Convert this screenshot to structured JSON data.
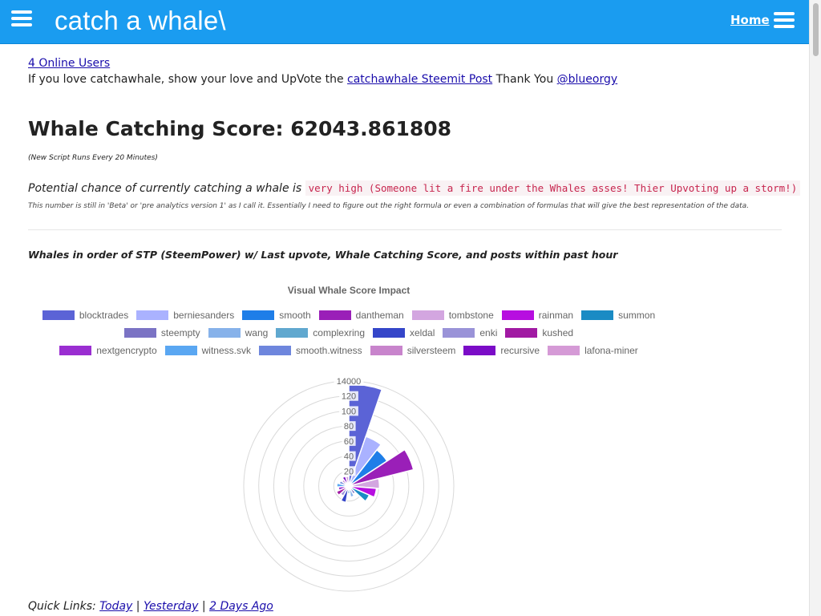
{
  "header": {
    "title": "catch a whale\\",
    "home_label": "Home"
  },
  "online_users": "4 Online Users",
  "love": {
    "prefix": "If you love catchawhale, show your love and UpVote the ",
    "post_link": "catchawhale Steemit Post",
    "middle": " Thank You ",
    "user_link": "@blueorgy"
  },
  "score_title": "Whale Catching Score: 62043.861808",
  "script_note": "(New Script Runs Every 20 Minutes)",
  "potential": {
    "prefix": "Potential chance of currently catching a whale is ",
    "value": "very high (Someone lit a fire under the Whales asses! Thier Upvoting up a storm!)"
  },
  "beta_note": "This number is still in 'Beta' or 'pre analytics version 1' as I call it. Essentially I need to figure out the right formula or even a combination of formulas that will give the best representation of the data.",
  "whales_heading": "Whales in order of STP (SteemPower) w/ Last upvote, Whale Catching Score, and posts within past hour",
  "quick_links": {
    "label": "Quick Links:",
    "today": "Today",
    "yesterday": "Yesterday",
    "two_days": "2 Days Ago"
  },
  "chart_data": {
    "type": "polarArea",
    "title": "Visual Whale Score Impact",
    "legend_position": "top",
    "r_ticks": [
      "20",
      "40",
      "60",
      "80",
      "100",
      "120",
      "14000"
    ],
    "rmax": 14000,
    "series": [
      {
        "name": "blocktrades",
        "value": 13600,
        "color": "#5b63d6"
      },
      {
        "name": "berniesanders",
        "value": 7000,
        "color": "#aab2ff"
      },
      {
        "name": "smooth",
        "value": 6100,
        "color": "#1e7ee8"
      },
      {
        "name": "dantheman",
        "value": 8900,
        "color": "#9a1fb8"
      },
      {
        "name": "tombstone",
        "value": 4100,
        "color": "#d3a6e0"
      },
      {
        "name": "rainman",
        "value": 3700,
        "color": "#b70ee0"
      },
      {
        "name": "summon",
        "value": 3000,
        "color": "#1a8bc4"
      },
      {
        "name": "steempty",
        "value": 1200,
        "color": "#7b73c4"
      },
      {
        "name": "wang",
        "value": 1500,
        "color": "#87b2ea"
      },
      {
        "name": "complexring",
        "value": 1000,
        "color": "#60a8cf"
      },
      {
        "name": "xeldal",
        "value": 2200,
        "color": "#3546c9"
      },
      {
        "name": "enki",
        "value": 1500,
        "color": "#9a93d8"
      },
      {
        "name": "kushed",
        "value": 1800,
        "color": "#a11aa3"
      },
      {
        "name": "nextgencrypto",
        "value": 1400,
        "color": "#9a2ed1"
      },
      {
        "name": "witness.svk",
        "value": 1600,
        "color": "#5aa7f2"
      },
      {
        "name": "smooth.witness",
        "value": 1300,
        "color": "#6e86dd"
      },
      {
        "name": "silversteem",
        "value": 1100,
        "color": "#c884cc"
      },
      {
        "name": "recursive",
        "value": 1400,
        "color": "#7b0cc7"
      },
      {
        "name": "lafona-miner",
        "value": 1300,
        "color": "#d59ad6"
      }
    ]
  }
}
